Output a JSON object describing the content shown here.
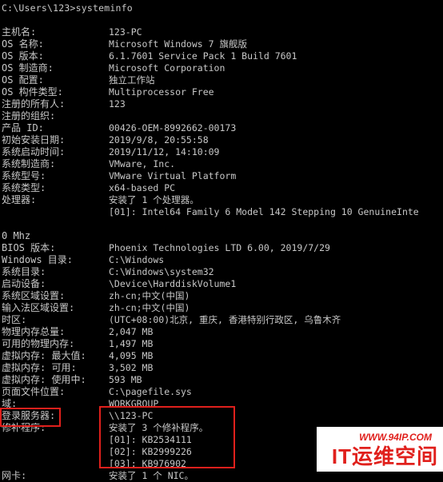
{
  "prompt": "C:\\Users\\123>systeminfo",
  "rows": [
    {
      "label": "主机名:",
      "value": "123-PC"
    },
    {
      "label": "OS 名称:",
      "value": "Microsoft Windows 7 旗舰版"
    },
    {
      "label": "OS 版本:",
      "value": "6.1.7601 Service Pack 1 Build 7601"
    },
    {
      "label": "OS 制造商:",
      "value": "Microsoft Corporation"
    },
    {
      "label": "OS 配置:",
      "value": "独立工作站"
    },
    {
      "label": "OS 构件类型:",
      "value": "Multiprocessor Free"
    },
    {
      "label": "注册的所有人:",
      "value": "123"
    },
    {
      "label": "注册的组织:",
      "value": ""
    },
    {
      "label": "产品 ID:",
      "value": "00426-OEM-8992662-00173"
    },
    {
      "label": "初始安装日期:",
      "value": "2019/9/8, 20:55:58"
    },
    {
      "label": "系统启动时间:",
      "value": "2019/11/12, 14:10:09"
    },
    {
      "label": "系统制造商:",
      "value": "VMware, Inc."
    },
    {
      "label": "系统型号:",
      "value": "VMware Virtual Platform"
    },
    {
      "label": "系统类型:",
      "value": "x64-based PC"
    },
    {
      "label": "处理器:",
      "value": "安装了 1 个处理器。"
    },
    {
      "label": "",
      "value": "[01]: Intel64 Family 6 Model 142 Stepping 10 GenuineInte"
    },
    {
      "label": "",
      "value": ""
    },
    {
      "label": "0 Mhz",
      "value": ""
    },
    {
      "label": "BIOS 版本:",
      "value": "Phoenix Technologies LTD 6.00, 2019/7/29"
    },
    {
      "label": "Windows 目录:",
      "value": "C:\\Windows"
    },
    {
      "label": "系统目录:",
      "value": "C:\\Windows\\system32"
    },
    {
      "label": "启动设备:",
      "value": "\\Device\\HarddiskVolume1"
    },
    {
      "label": "系统区域设置:",
      "value": "zh-cn;中文(中国)"
    },
    {
      "label": "输入法区域设置:",
      "value": "zh-cn;中文(中国)"
    },
    {
      "label": "时区:",
      "value": "(UTC+08:00)北京, 重庆, 香港特别行政区, 乌鲁木齐"
    },
    {
      "label": "物理内存总量:",
      "value": "2,047 MB"
    },
    {
      "label": "可用的物理内存:",
      "value": "1,497 MB"
    },
    {
      "label": "虚拟内存: 最大值:",
      "value": "4,095 MB"
    },
    {
      "label": "虚拟内存: 可用:",
      "value": "3,502 MB"
    },
    {
      "label": "虚拟内存: 使用中:",
      "value": "593 MB"
    },
    {
      "label": "页面文件位置:",
      "value": "C:\\pagefile.sys"
    },
    {
      "label": "域:",
      "value": "WORKGROUP"
    },
    {
      "label": "登录服务器:",
      "value": "\\\\123-PC"
    },
    {
      "label": "修补程序:",
      "value": "安装了 3 个修补程序。"
    },
    {
      "label": "",
      "value": "[01]: KB2534111"
    },
    {
      "label": "",
      "value": "[02]: KB2999226"
    },
    {
      "label": "",
      "value": "[03]: KB976902"
    },
    {
      "label": "网卡:",
      "value": "安装了 1 个 NIC。"
    }
  ],
  "watermark": {
    "url": "WWW.94IP.COM",
    "text": "IT运维空间"
  },
  "highlight_color": "#e0201c"
}
